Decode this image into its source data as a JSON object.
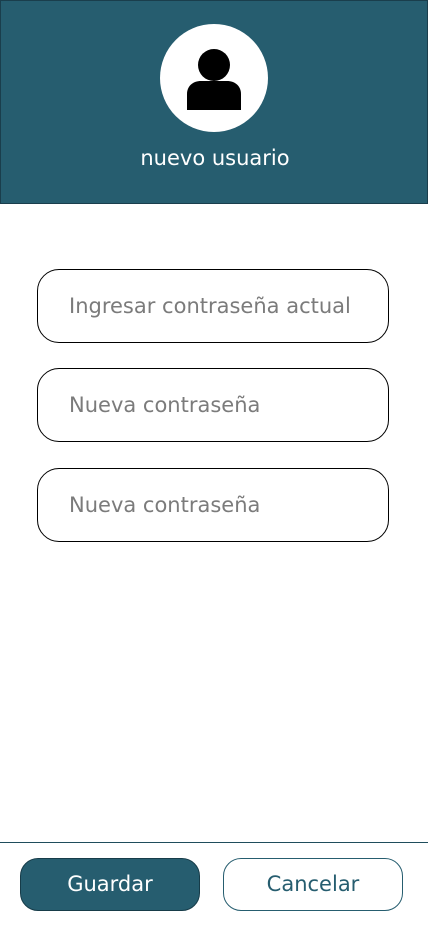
{
  "colors": {
    "brand": "#265d6f",
    "field_border": "#000000",
    "placeholder": "#7b7b7b"
  },
  "header": {
    "avatar_icon": "user-icon",
    "username": "nuevo usuario"
  },
  "form": {
    "fields": [
      {
        "placeholder": "Ingresar contraseña actual",
        "value": ""
      },
      {
        "placeholder": "Nueva contraseña",
        "value": ""
      },
      {
        "placeholder": "Nueva contraseña",
        "value": ""
      }
    ]
  },
  "footer": {
    "save_label": "Guardar",
    "cancel_label": "Cancelar"
  }
}
